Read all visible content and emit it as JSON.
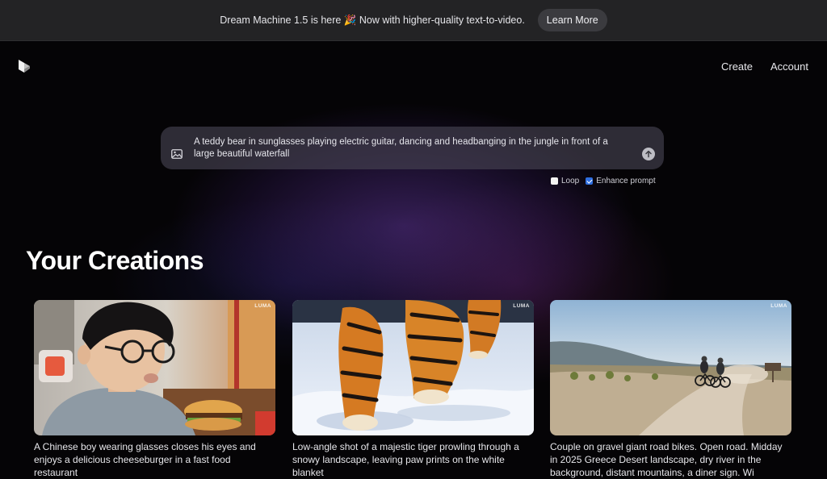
{
  "banner": {
    "text": "Dream Machine 1.5 is here 🎉 Now with higher-quality text-to-video.",
    "button": "Learn More"
  },
  "logo": {
    "icon": "luma-cube-logo-icon"
  },
  "nav": {
    "create": "Create",
    "account": "Account"
  },
  "prompt": {
    "value": "A teddy bear in sunglasses playing electric guitar, dancing and headbanging in the jungle in front of a large beautiful waterfall",
    "image_icon": "image-upload-icon",
    "send_icon": "arrow-up-icon"
  },
  "options": {
    "loop": {
      "label": "Loop",
      "checked": false
    },
    "enhance": {
      "label": "Enhance prompt",
      "checked": true
    }
  },
  "section_title": "Your Creations",
  "cards": [
    {
      "watermark": "LUMA",
      "caption": "A Chinese boy wearing glasses closes his eyes and enjoys a delicious cheeseburger in a fast food restaurant"
    },
    {
      "watermark": "LUMA",
      "caption": "Low-angle shot of a majestic tiger prowling through a snowy landscape, leaving paw prints on the white blanket"
    },
    {
      "watermark": "LUMA",
      "caption": "Couple on gravel giant road bikes. Open road. Midday in 2025 Greece Desert landscape, dry river in the background, distant mountains, a diner sign. Wi"
    }
  ],
  "colors": {
    "background": "#050406",
    "banner": "#232325",
    "checkbox_on": "#2f6fe0"
  }
}
